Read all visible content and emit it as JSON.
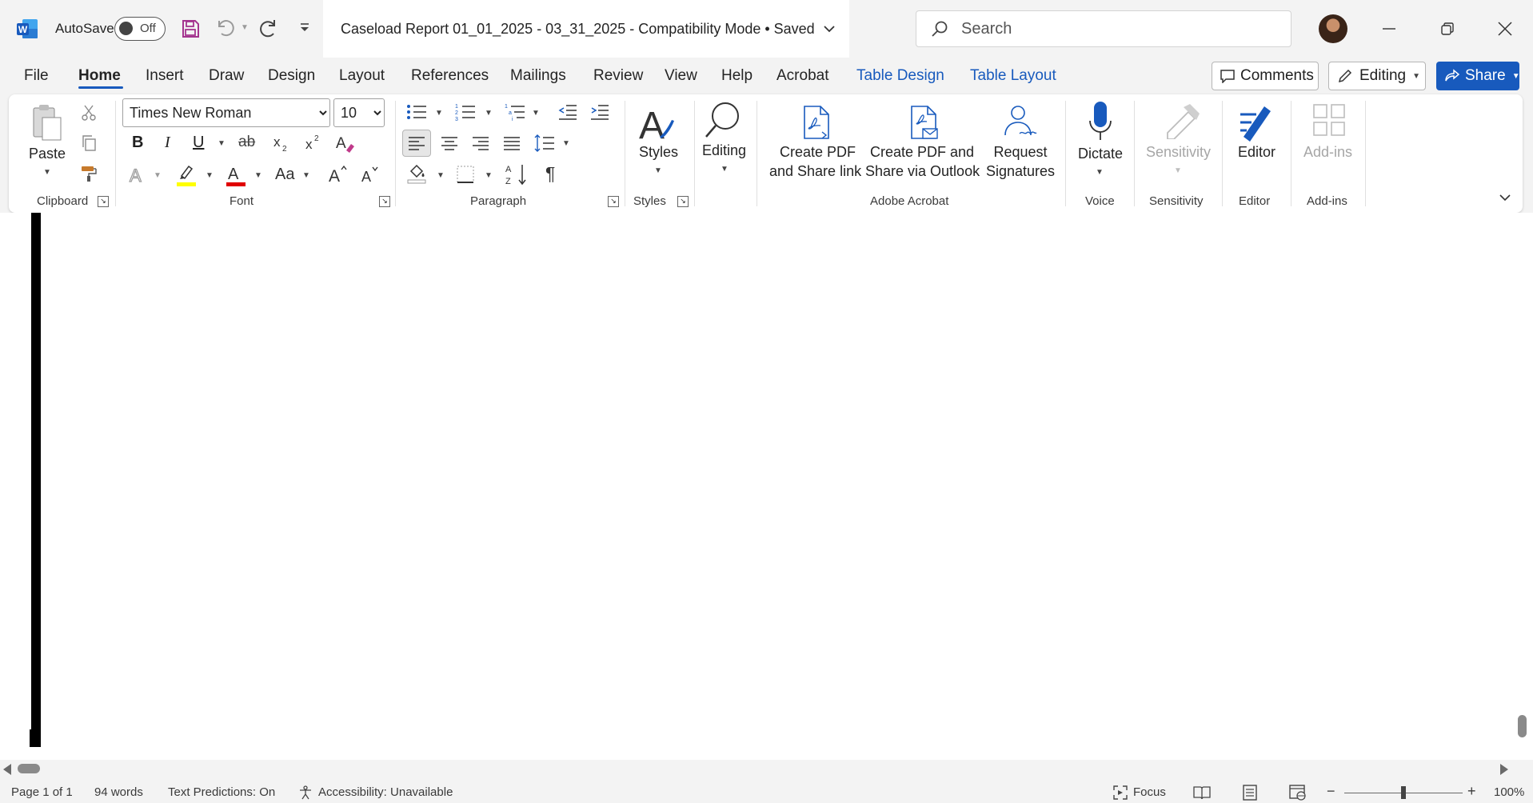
{
  "titlebar": {
    "autosave_label": "AutoSave",
    "autosave_state": "Off",
    "doc_title": "Caseload Report 01_01_2025 - 03_31_2025  -  Compatibility Mode • Saved",
    "search_placeholder": "Search"
  },
  "menu": {
    "tabs": [
      "File",
      "Home",
      "Insert",
      "Draw",
      "Design",
      "Layout",
      "References",
      "Mailings",
      "Review",
      "View",
      "Help",
      "Acrobat",
      "Table Design",
      "Table Layout"
    ],
    "active_tab": "Home",
    "comments_label": "Comments",
    "editing_label": "Editing",
    "share_label": "Share"
  },
  "ribbon": {
    "clipboard": {
      "label": "Clipboard",
      "paste": "Paste"
    },
    "font": {
      "label": "Font",
      "font_name": "Times New Roman",
      "font_size": "10",
      "bold": "B",
      "italic": "I",
      "underline": "U",
      "strike": "ab",
      "change_case": "Aa"
    },
    "paragraph": {
      "label": "Paragraph"
    },
    "styles": {
      "label": "Styles",
      "styles_button": "Styles"
    },
    "editing": {
      "editing_button": "Editing"
    },
    "acrobat": {
      "label": "Adobe Acrobat",
      "create_pdf_share_line1": "Create PDF",
      "create_pdf_share_line2": "and Share link",
      "create_pdf_outlook_line1": "Create PDF and",
      "create_pdf_outlook_line2": "Share via Outlook",
      "request_sig_line1": "Request",
      "request_sig_line2": "Signatures"
    },
    "voice": {
      "label": "Voice",
      "dictate": "Dictate"
    },
    "sensitivity": {
      "label": "Sensitivity",
      "button": "Sensitivity"
    },
    "editor": {
      "label": "Editor",
      "button": "Editor"
    },
    "addins": {
      "label": "Add-ins",
      "button": "Add-ins"
    }
  },
  "status": {
    "page": "Page 1 of 1",
    "words": "94 words",
    "text_predictions": "Text Predictions: On",
    "accessibility": "Accessibility: Unavailable",
    "focus": "Focus",
    "zoom": "100%"
  },
  "colors": {
    "accent": "#185abd",
    "word_blue": "#2b579a",
    "save_purple": "#a4358f"
  }
}
